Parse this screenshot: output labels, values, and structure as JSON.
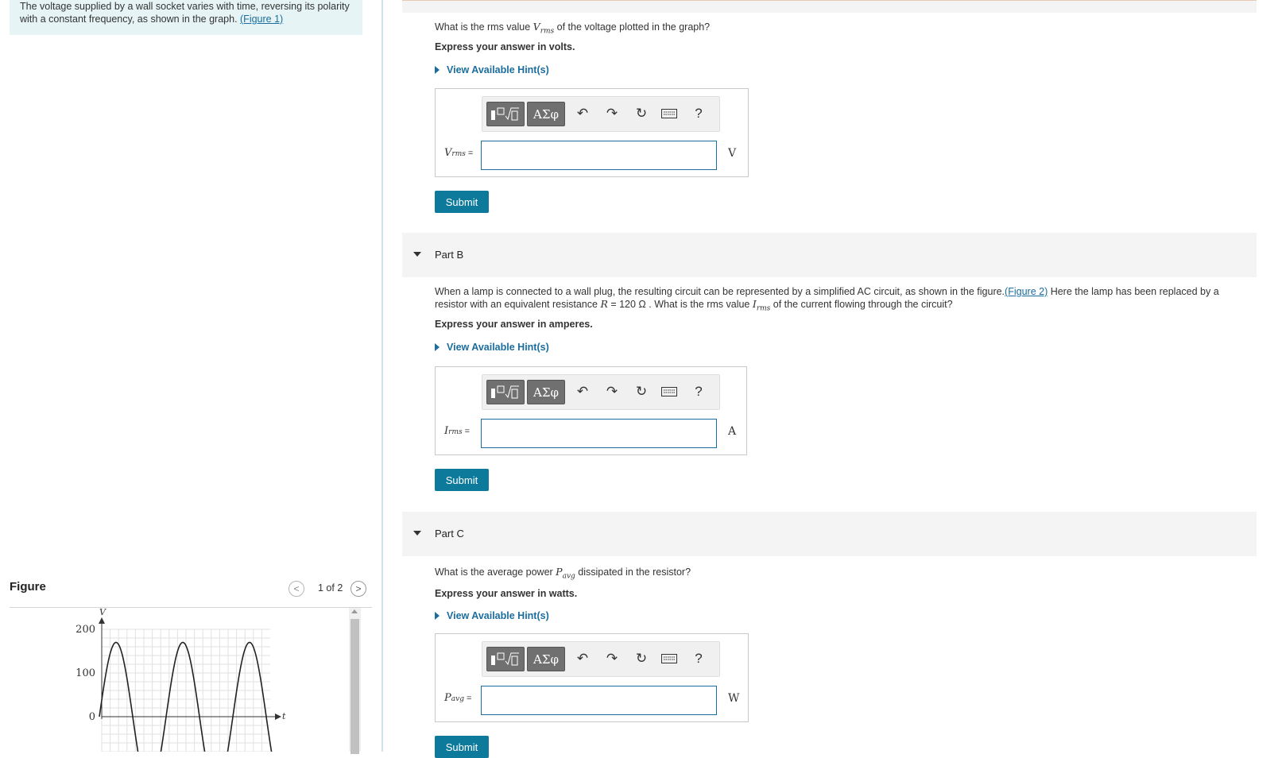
{
  "intro": {
    "text": "The voltage supplied by a wall socket varies with time, reversing its polarity with a constant frequency, as shown in the graph. ",
    "figure_link": "(Figure 1)"
  },
  "figure": {
    "title": "Figure",
    "page": "1 of 2",
    "prev": "<",
    "next": ">"
  },
  "graph": {
    "ylabel": "V",
    "xlabel": "t",
    "ticks": [
      "200",
      "100",
      "0"
    ]
  },
  "chart_data": {
    "type": "line",
    "title": "",
    "xlabel": "t",
    "ylabel": "V",
    "y_ticks": [
      0,
      100,
      200
    ],
    "ylim": [
      0,
      200
    ],
    "grid": true,
    "series": [
      {
        "values": [
          0,
          170,
          0,
          170,
          0,
          170,
          0
        ]
      }
    ]
  },
  "partA": {
    "question_pre": "What is the rms value ",
    "var": "V",
    "var_sub": "rms",
    "question_post": " of the voltage plotted in the graph?",
    "express": "Express your answer in volts.",
    "hint": "View Available Hint(s)",
    "label": "V",
    "label_sub": "rms",
    "eq": "=",
    "unit": "V",
    "submit": "Submit"
  },
  "partB": {
    "head": "Part B",
    "text1": "When a lamp is connected to a wall plug, the resulting circuit can be represented by a simplified AC circuit, as shown in the figure.",
    "fig_link": "(Figure 2)",
    "text2": " Here the lamp has been replaced by a",
    "text3_pre": "resistor with an equivalent resistance ",
    "R": "R",
    "r_value": " = 120 Ω",
    "text3_mid": " . What is the rms value ",
    "I": "I",
    "I_sub": "rms",
    "text3_post": " of the current flowing through the circuit?",
    "express": "Express your answer in amperes.",
    "hint": "View Available Hint(s)",
    "label": "I",
    "label_sub": "rms",
    "eq": "=",
    "unit": "A",
    "submit": "Submit"
  },
  "partC": {
    "head": "Part C",
    "question_pre": "What is the average power ",
    "P": "P",
    "P_sub": "avg",
    "question_post": " dissipated in the resistor?",
    "express": "Express your answer in watts.",
    "hint": "View Available Hint(s)",
    "label": "P",
    "label_sub": "avg",
    "eq": "=",
    "unit": "W",
    "submit": "Submit"
  },
  "toolbar": {
    "symbols": "ΑΣφ",
    "help": "?"
  }
}
